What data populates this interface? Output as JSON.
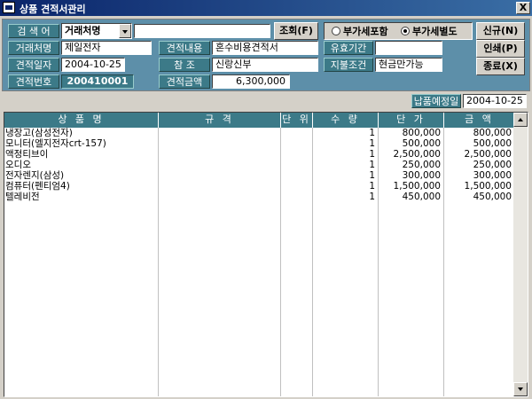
{
  "window": {
    "title": "상품 견적서관리",
    "close_label": "X"
  },
  "search": {
    "label": "검 색 어",
    "field": "거래처명",
    "query": "",
    "button": "조회(F)"
  },
  "vat": {
    "include_label": "부가세포함",
    "separate_label": "부가세별도",
    "selected": "separate"
  },
  "buttons": {
    "new": "신규(N)",
    "print": "인쇄(P)",
    "close": "종료(X)"
  },
  "form": {
    "client_label": "거래처명",
    "client_value": "제일전자",
    "content_label": "견적내용",
    "content_value": "혼수비용견적서",
    "validity_label": "유효기간",
    "validity_value": "",
    "date_label": "견적일자",
    "date_value": "2004-10-25",
    "ref_label": "참 조",
    "ref_value": "신랑신부",
    "payment_label": "지불조건",
    "payment_value": "현금만가능",
    "no_label": "견적번호",
    "no_value": "200410001",
    "amount_label": "견적금액",
    "amount_value": "6,300,000"
  },
  "delivery": {
    "label": "납품예정일",
    "value": "2004-10-25"
  },
  "table": {
    "columns": [
      "상 품 명",
      "규 격",
      "단 위",
      "수 량",
      "단 가",
      "금 액"
    ],
    "rows": [
      {
        "name": "냉장고(삼성전자)",
        "spec": "",
        "unit": "",
        "qty": "1",
        "price": "800,000",
        "amount": "800,000"
      },
      {
        "name": "모니터(엘지전자crt-157)",
        "spec": "",
        "unit": "",
        "qty": "1",
        "price": "500,000",
        "amount": "500,000"
      },
      {
        "name": "액정티브이",
        "spec": "",
        "unit": "",
        "qty": "1",
        "price": "2,500,000",
        "amount": "2,500,000"
      },
      {
        "name": "오디오",
        "spec": "",
        "unit": "",
        "qty": "1",
        "price": "250,000",
        "amount": "250,000"
      },
      {
        "name": "전자렌지(삼성)",
        "spec": "",
        "unit": "",
        "qty": "1",
        "price": "300,000",
        "amount": "300,000"
      },
      {
        "name": "컴퓨터(펜티엄4)",
        "spec": "",
        "unit": "",
        "qty": "1",
        "price": "1,500,000",
        "amount": "1,500,000"
      },
      {
        "name": "텔레비전",
        "spec": "",
        "unit": "",
        "qty": "1",
        "price": "450,000",
        "amount": "450,000"
      }
    ]
  },
  "colors": {
    "panel": "#5d8fa9",
    "label_bg": "#3c7a88",
    "title_start": "#0a246a"
  },
  "icons": {
    "app": "window-app-icon",
    "close": "close-icon"
  }
}
